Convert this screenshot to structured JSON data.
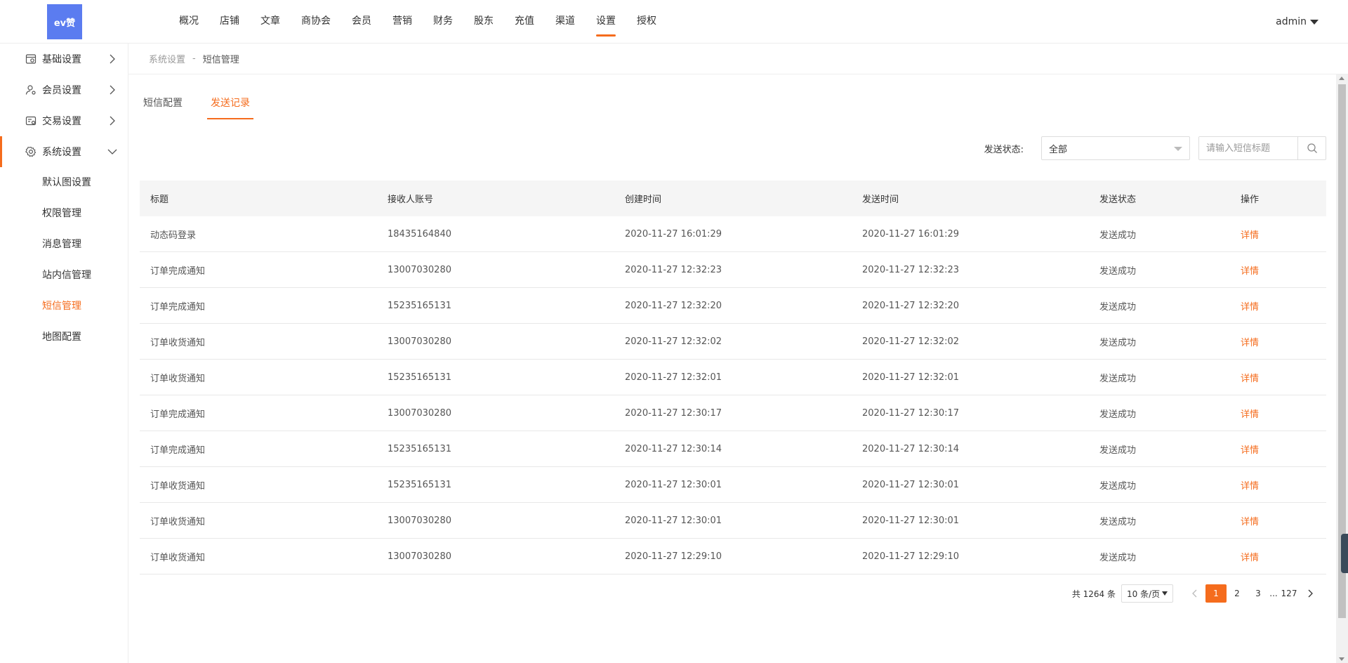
{
  "header": {
    "logo_text": "ev赞",
    "nav": [
      {
        "label": "概况",
        "active": false
      },
      {
        "label": "店铺",
        "active": false
      },
      {
        "label": "文章",
        "active": false
      },
      {
        "label": "商协会",
        "active": false
      },
      {
        "label": "会员",
        "active": false
      },
      {
        "label": "营销",
        "active": false
      },
      {
        "label": "财务",
        "active": false
      },
      {
        "label": "股东",
        "active": false
      },
      {
        "label": "充值",
        "active": false
      },
      {
        "label": "渠道",
        "active": false
      },
      {
        "label": "设置",
        "active": true
      },
      {
        "label": "授权",
        "active": false
      }
    ],
    "user": "admin"
  },
  "sidebar": {
    "groups": [
      {
        "label": "基础设置",
        "icon": "settings-icon",
        "expanded": false
      },
      {
        "label": "会员设置",
        "icon": "user-settings-icon",
        "expanded": false
      },
      {
        "label": "交易设置",
        "icon": "trade-icon",
        "expanded": false
      },
      {
        "label": "系统设置",
        "icon": "gear-icon",
        "expanded": true
      }
    ],
    "sub_items": [
      {
        "label": "默认图设置",
        "active": false
      },
      {
        "label": "权限管理",
        "active": false
      },
      {
        "label": "消息管理",
        "active": false
      },
      {
        "label": "站内信管理",
        "active": false
      },
      {
        "label": "短信管理",
        "active": true
      },
      {
        "label": "地图配置",
        "active": false
      }
    ]
  },
  "breadcrumb": {
    "parent": "系统设置",
    "separator": "-",
    "current": "短信管理"
  },
  "tabs": [
    {
      "label": "短信配置",
      "active": false
    },
    {
      "label": "发送记录",
      "active": true
    }
  ],
  "filter": {
    "status_label": "发送状态:",
    "status_value": "全部",
    "search_placeholder": "请输入短信标题"
  },
  "table": {
    "headers": [
      "标题",
      "接收人账号",
      "创建时间",
      "发送时间",
      "发送状态",
      "操作"
    ],
    "rows": [
      {
        "title": "动态码登录",
        "account": "18435164840",
        "created": "2020-11-27 16:01:29",
        "sent": "2020-11-27 16:01:29",
        "status": "发送成功",
        "action": "详情"
      },
      {
        "title": "订单完成通知",
        "account": "13007030280",
        "created": "2020-11-27 12:32:23",
        "sent": "2020-11-27 12:32:23",
        "status": "发送成功",
        "action": "详情"
      },
      {
        "title": "订单完成通知",
        "account": "15235165131",
        "created": "2020-11-27 12:32:20",
        "sent": "2020-11-27 12:32:20",
        "status": "发送成功",
        "action": "详情"
      },
      {
        "title": "订单收货通知",
        "account": "13007030280",
        "created": "2020-11-27 12:32:02",
        "sent": "2020-11-27 12:32:02",
        "status": "发送成功",
        "action": "详情"
      },
      {
        "title": "订单收货通知",
        "account": "15235165131",
        "created": "2020-11-27 12:32:01",
        "sent": "2020-11-27 12:32:01",
        "status": "发送成功",
        "action": "详情"
      },
      {
        "title": "订单完成通知",
        "account": "13007030280",
        "created": "2020-11-27 12:30:17",
        "sent": "2020-11-27 12:30:17",
        "status": "发送成功",
        "action": "详情"
      },
      {
        "title": "订单完成通知",
        "account": "15235165131",
        "created": "2020-11-27 12:30:14",
        "sent": "2020-11-27 12:30:14",
        "status": "发送成功",
        "action": "详情"
      },
      {
        "title": "订单收货通知",
        "account": "15235165131",
        "created": "2020-11-27 12:30:01",
        "sent": "2020-11-27 12:30:01",
        "status": "发送成功",
        "action": "详情"
      },
      {
        "title": "订单收货通知",
        "account": "13007030280",
        "created": "2020-11-27 12:30:01",
        "sent": "2020-11-27 12:30:01",
        "status": "发送成功",
        "action": "详情"
      },
      {
        "title": "订单收货通知",
        "account": "13007030280",
        "created": "2020-11-27 12:29:10",
        "sent": "2020-11-27 12:29:10",
        "status": "发送成功",
        "action": "详情"
      }
    ]
  },
  "pagination": {
    "total": "共 1264 条",
    "page_size": "10 条/页",
    "pages": [
      "1",
      "2",
      "3",
      "...",
      "127"
    ],
    "current": "1"
  },
  "colors": {
    "accent": "#f56c1d",
    "logo_bg": "#5b7cf0"
  }
}
